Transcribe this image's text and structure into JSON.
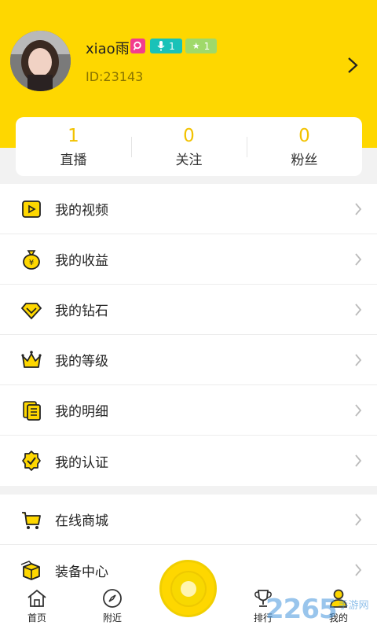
{
  "profile": {
    "username": "xiao雨",
    "user_id": "ID:23143",
    "badges": {
      "search_icon": "magnify-icon",
      "mic_level": "1",
      "star_level": "1"
    }
  },
  "stats": [
    {
      "value": "1",
      "label": "直播"
    },
    {
      "value": "0",
      "label": "关注"
    },
    {
      "value": "0",
      "label": "粉丝"
    }
  ],
  "menu_group_1": [
    {
      "label": "我的视频",
      "icon": "video-icon"
    },
    {
      "label": "我的收益",
      "icon": "money-bag-icon"
    },
    {
      "label": "我的钻石",
      "icon": "diamond-icon"
    },
    {
      "label": "我的等级",
      "icon": "crown-icon"
    },
    {
      "label": "我的明细",
      "icon": "document-icon"
    },
    {
      "label": "我的认证",
      "icon": "verified-badge-icon"
    }
  ],
  "menu_group_2": [
    {
      "label": "在线商城",
      "icon": "cart-icon"
    },
    {
      "label": "装备中心",
      "icon": "box-icon"
    }
  ],
  "tabbar": {
    "home": "首页",
    "nearby": "附近",
    "ranking": "排行",
    "mine": "我的"
  },
  "watermark": {
    "number": "2265",
    "text": "手游网"
  },
  "colors": {
    "brand_yellow": "#fed700",
    "accent_number": "#f2c200"
  }
}
